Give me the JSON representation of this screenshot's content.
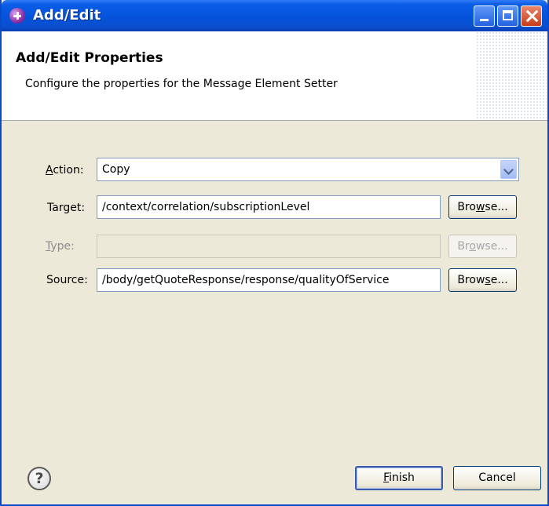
{
  "window": {
    "title": "Add/Edit"
  },
  "header": {
    "title": "Add/Edit Properties",
    "description": "Configure the properties for the Message Element Setter"
  },
  "form": {
    "action": {
      "label_mnemonic": "A",
      "label_rest": "ction:",
      "value": "Copy"
    },
    "target": {
      "label": "Target:",
      "value": "/context/correlation/subscriptionLevel",
      "browse_pre": "Bro",
      "browse_mn": "w",
      "browse_post": "se..."
    },
    "type": {
      "label_mnemonic": "T",
      "label_rest": "ype:",
      "value": "",
      "browse_pre": "Br",
      "browse_mn": "o",
      "browse_post": "wse..."
    },
    "source": {
      "label": "Source:",
      "value": "/body/getQuoteResponse/response/qualityOfService",
      "browse_pre": "Brow",
      "browse_mn": "s",
      "browse_post": "e..."
    }
  },
  "footer": {
    "help_icon": "question-mark-icon",
    "finish_mnemonic": "F",
    "finish_rest": "inish",
    "cancel_label": "Cancel"
  }
}
